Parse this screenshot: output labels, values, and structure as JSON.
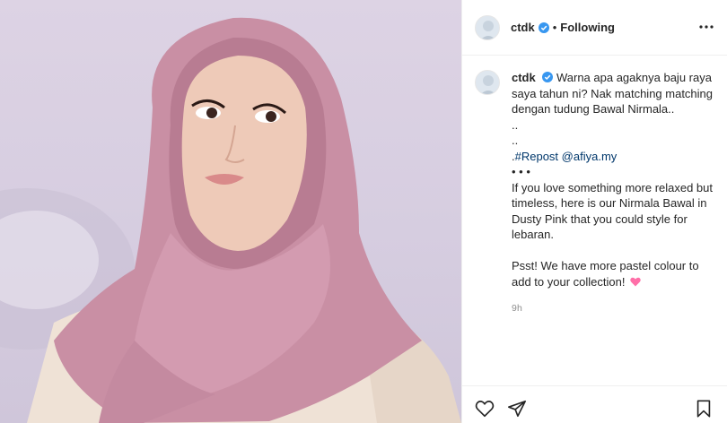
{
  "post": {
    "author": {
      "username": "ctdk",
      "verified": true,
      "follow_status": "Following"
    },
    "caption": {
      "username": "ctdk",
      "lines": [
        "Warna apa agaknya baju raya",
        "saya tahun ni? Nak matching matching",
        "dengan tudung Bawal Nirmala..",
        "..",
        "..",
        ".",
        "#Repost",
        "@afiya.my",
        "• • •",
        "If you love something more relaxed but",
        "timeless, here is our Nirmala Bawal in",
        "Dusty Pink that you could style for",
        "lebaran.",
        "Psst! We have more pastel colour to",
        "add to your collection!"
      ],
      "emoji": "pink-heart",
      "timestamp": "9h"
    },
    "separator": "•",
    "icons": {
      "more": "more-options-icon",
      "like": "heart-icon",
      "share": "paper-plane-icon",
      "save": "bookmark-icon",
      "verified": "verified-badge-icon"
    },
    "colors": {
      "verified": "#3897f0",
      "link": "#00376b",
      "muted": "#8e8e8e",
      "hijab": "#c98fa4",
      "background": "#d8cfe2"
    }
  }
}
